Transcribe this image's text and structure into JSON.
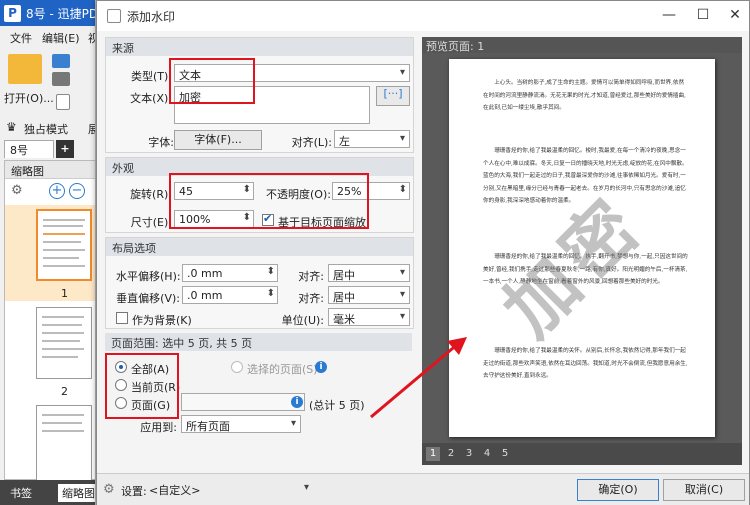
{
  "app": {
    "title": "8号 - 迅捷PD",
    "menu": [
      "文件",
      "编辑(E)",
      "视"
    ],
    "open_label": "打开(O)...",
    "mode_label": "独占模式",
    "mode_suffix": "展",
    "doc_tab": "8号",
    "add_tab": "+",
    "thumbnails_header": "缩略图",
    "thumb_pages": [
      "1",
      "2"
    ],
    "bottom_tabs": [
      "书签",
      "缩略图"
    ]
  },
  "dialog": {
    "title": "添加水印",
    "window_controls": {
      "minimize": "—",
      "maximize": "☐",
      "close": "✕"
    },
    "source": {
      "header": "来源",
      "type_label": "类型(T):",
      "type_value": "文本",
      "text_label": "文本(X):",
      "text_value": "加密",
      "insert_button": "[···]",
      "font_label": "字体:",
      "font_button": "字体(F)...",
      "align_label": "对齐(L):",
      "align_value": "左"
    },
    "appearance": {
      "header": "外观",
      "rotation_label": "旋转(R):",
      "rotation_value": "45",
      "opacity_label": "不透明度(O):",
      "opacity_value": "25%",
      "size_label": "尺寸(E):",
      "size_value": "100%",
      "scale_checkbox_label": "基于目标页面缩放",
      "scale_checked": true
    },
    "layout": {
      "header": "布局选项",
      "h_offset_label": "水平偏移(H):",
      "h_offset_value": ".0 mm",
      "h_align_label": "对齐:",
      "h_align_value": "居中",
      "v_offset_label": "垂直偏移(V):",
      "v_offset_value": ".0 mm",
      "v_align_label": "对齐:",
      "v_align_value": "居中",
      "background_label": "作为背景(K)",
      "unit_label": "单位(U):",
      "unit_value": "毫米"
    },
    "page_range": {
      "header": "页面范围: 选中 5 页, 共 5 页",
      "all_label": "全部(A)",
      "current_label": "当前页(R)",
      "pages_label": "页面(G)",
      "selected_pages_label": "选择的页面(S)",
      "total_label": "(总计 5 页)",
      "apply_label": "应用到:",
      "apply_value": "所有页面",
      "selected_option": "all"
    },
    "preview": {
      "header": "预览页面: 1",
      "watermark_text": "加密",
      "pages": [
        "1",
        "2",
        "3",
        "4",
        "5"
      ],
      "active_page": "1",
      "paragraphs": [
        "上心头。当树的影子,成了生命的主题。爱情可以简单得如同呼吸,而世界,依然在时间的河流里静静流淌。无花无果的时光,才知道,曾经爱过,那些美好的爱情插曲,在此刻,已如一缕尘埃,散乎其间。",
        "珊珊香烃的你,给了我最温柔的回忆。梭时,我最爱,在每一个清冷的夜晚,思念一个人在心中,难以成寐。冬天,日复一日的播晓天地,时光无虑,绽放的花,在风中飘散。蓝色的大海,我们一起走过的日子,我曾最深爱你的沙滩,往事依稀如月光。爱有时,一分别,又在黑暗里,缘分已经与青春一起老去。在岁月的长河中,只有思念的沙滩,追忆你的身影,我深深地感动着你的温柔。",
        "珊珊香烃的你,给了我最温柔的回忆。执手,翻开书,梦想与你,一起,只因这世间的美好,曾经,我们携手,走过那些春夏秋冬,一路,有你,真好。阳光明媚的午后,一杯清茶,一本书,一个人,静静地坐在窗前,看着窗外的风景,回想着那些美好的时光。",
        "珊珊香烃的你,给了我最温柔的关怀。从别后,长怀念,我依然记得,那年我们一起走过的街道,那些欢声笑语,依然在耳边回荡。我知道,时光不会倒流,但我愿意用余生,去守护这份美好,直到永远。"
      ]
    },
    "footer": {
      "settings_label": "设置:",
      "settings_value": "<自定义>",
      "ok_button": "确定(O)",
      "cancel_button": "取消(C)"
    }
  },
  "colors": {
    "highlight": "#e0141e",
    "titlebar": "#1f63c4",
    "accent": "#1a5fb4"
  }
}
